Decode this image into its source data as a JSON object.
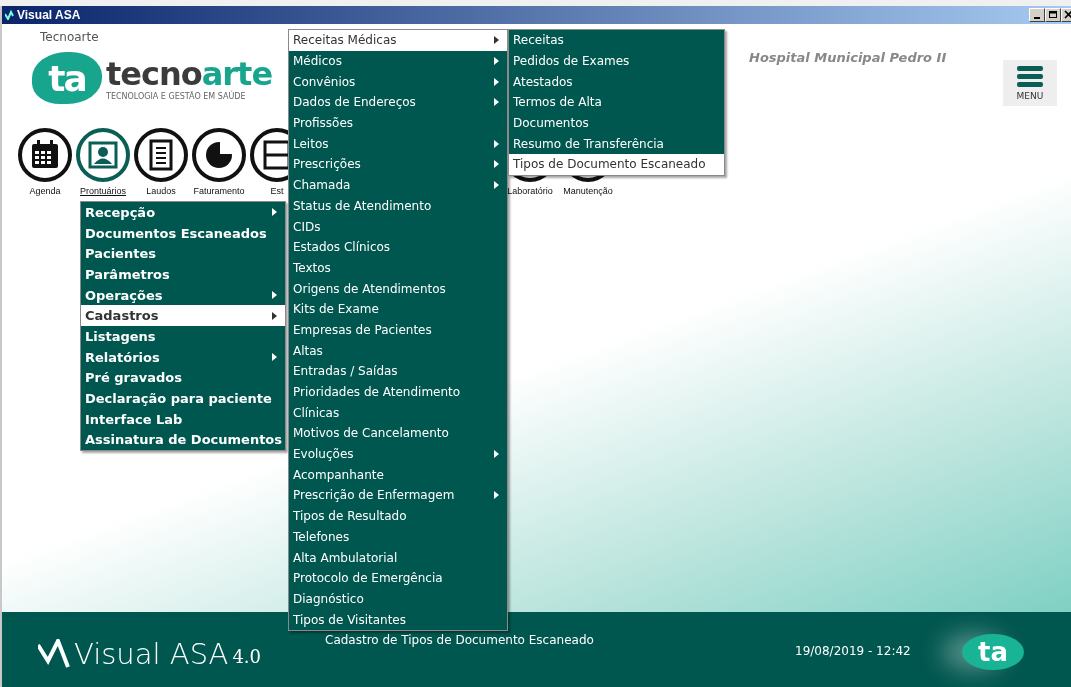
{
  "window": {
    "title": "Visual ASA"
  },
  "company": "Tecnoarte",
  "logo": {
    "mark": "ta",
    "name_main": "tecno",
    "name_accent": "arte",
    "tagline": "TECNOLOGIA E GESTÃO EM SAÚDE"
  },
  "hospital": "Hospital Municipal Pedro II",
  "menu_button": {
    "label": "MENU"
  },
  "modules": [
    {
      "label": "Agenda",
      "kind": "calendar",
      "selected": false
    },
    {
      "label": "Prontuários",
      "kind": "person",
      "selected": true
    },
    {
      "label": "Laudos",
      "kind": "document",
      "selected": false
    },
    {
      "label": "Faturamento",
      "kind": "pie",
      "selected": false
    },
    {
      "label": "Est",
      "kind": "grid",
      "selected": false
    },
    {
      "label": "Laboratório",
      "kind": "ring",
      "selected": false
    },
    {
      "label": "Manutenção",
      "kind": "ring",
      "selected": false
    }
  ],
  "menus": [
    {
      "items": [
        {
          "label": "Recepção",
          "submenu": true,
          "selected": false
        },
        {
          "label": "Documentos Escaneados",
          "submenu": false,
          "selected": false
        },
        {
          "label": "Pacientes",
          "submenu": false,
          "selected": false
        },
        {
          "label": "Parâmetros",
          "submenu": false,
          "selected": false
        },
        {
          "label": "Operações",
          "submenu": true,
          "selected": false
        },
        {
          "label": "Cadastros",
          "submenu": true,
          "selected": true
        },
        {
          "label": "Listagens",
          "submenu": false,
          "selected": false
        },
        {
          "label": "Relatórios",
          "submenu": true,
          "selected": false
        },
        {
          "label": "Pré gravados",
          "submenu": false,
          "selected": false
        },
        {
          "label": "Declaração para paciente",
          "submenu": false,
          "selected": false
        },
        {
          "label": "Interface Lab",
          "submenu": false,
          "selected": false
        },
        {
          "label": "Assinatura de Documentos",
          "submenu": false,
          "selected": false
        }
      ]
    },
    {
      "items": [
        {
          "label": "Receitas Médicas",
          "submenu": true,
          "selected": true
        },
        {
          "label": "Médicos",
          "submenu": true,
          "selected": false
        },
        {
          "label": "Convênios",
          "submenu": true,
          "selected": false
        },
        {
          "label": "Dados de Endereços",
          "submenu": true,
          "selected": false
        },
        {
          "label": "Profissões",
          "submenu": false,
          "selected": false
        },
        {
          "label": "Leitos",
          "submenu": true,
          "selected": false
        },
        {
          "label": "Prescrições",
          "submenu": true,
          "selected": false
        },
        {
          "label": "Chamada",
          "submenu": true,
          "selected": false
        },
        {
          "label": "Status de Atendimento",
          "submenu": false,
          "selected": false
        },
        {
          "label": "CIDs",
          "submenu": false,
          "selected": false
        },
        {
          "label": "Estados Clínicos",
          "submenu": false,
          "selected": false
        },
        {
          "label": "Textos",
          "submenu": false,
          "selected": false
        },
        {
          "label": "Origens de Atendimentos",
          "submenu": false,
          "selected": false
        },
        {
          "label": "Kits de Exame",
          "submenu": false,
          "selected": false
        },
        {
          "label": "Empresas de Pacientes",
          "submenu": false,
          "selected": false
        },
        {
          "label": "Altas",
          "submenu": false,
          "selected": false
        },
        {
          "label": "Entradas / Saídas",
          "submenu": false,
          "selected": false
        },
        {
          "label": "Prioridades de Atendimento",
          "submenu": false,
          "selected": false
        },
        {
          "label": "Clínicas",
          "submenu": false,
          "selected": false
        },
        {
          "label": "Motivos de Cancelamento",
          "submenu": false,
          "selected": false
        },
        {
          "label": "Evoluções",
          "submenu": true,
          "selected": false
        },
        {
          "label": "Acompanhante",
          "submenu": false,
          "selected": false
        },
        {
          "label": "Prescrição de Enfermagem",
          "submenu": true,
          "selected": false
        },
        {
          "label": "Tipos de Resultado",
          "submenu": false,
          "selected": false
        },
        {
          "label": "Telefones",
          "submenu": false,
          "selected": false
        },
        {
          "label": "Alta Ambulatorial",
          "submenu": false,
          "selected": false
        },
        {
          "label": "Protocolo de Emergência",
          "submenu": false,
          "selected": false
        },
        {
          "label": "Diagnóstico",
          "submenu": false,
          "selected": false
        },
        {
          "label": "Tipos de Visitantes",
          "submenu": false,
          "selected": false
        }
      ]
    },
    {
      "items": [
        {
          "label": "Receitas",
          "submenu": false,
          "selected": false
        },
        {
          "label": "Pedidos de Exames",
          "submenu": false,
          "selected": false
        },
        {
          "label": "Atestados",
          "submenu": false,
          "selected": false
        },
        {
          "label": "Termos de Alta",
          "submenu": false,
          "selected": false
        },
        {
          "label": "Documentos",
          "submenu": false,
          "selected": false
        },
        {
          "label": "Resumo de Transferência",
          "submenu": false,
          "selected": false
        },
        {
          "label": "Tipos de Documento Escaneado",
          "submenu": false,
          "selected": true
        }
      ]
    }
  ],
  "footer": {
    "brand": "Visual ASA",
    "version": "4.0",
    "status": "Cadastro de Tipos de Documento Escaneado",
    "datetime": "19/08/2019 - 12:42",
    "logo": "ta"
  }
}
